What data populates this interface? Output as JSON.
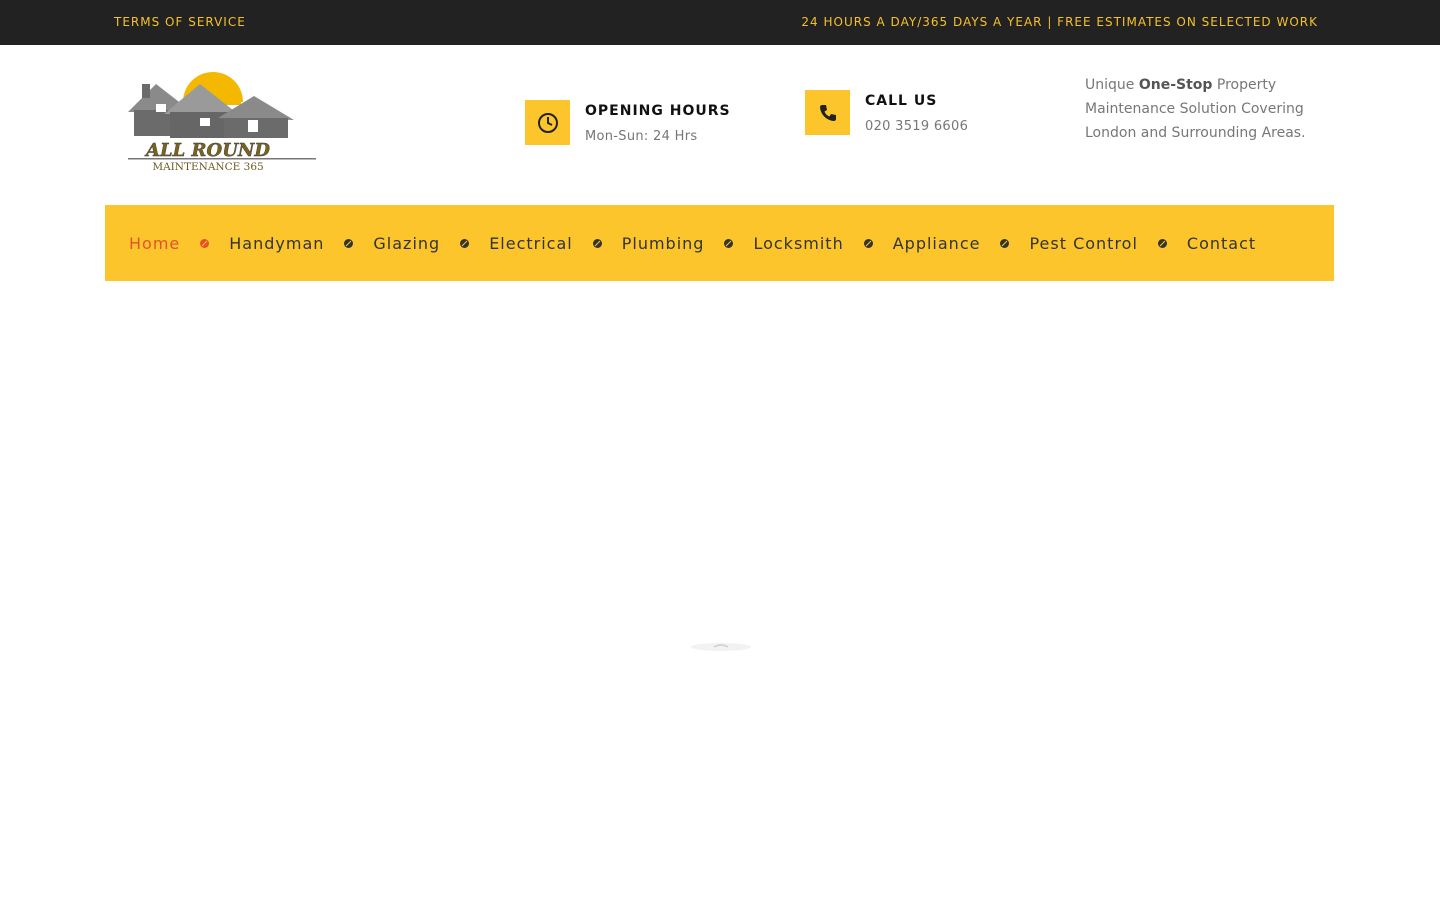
{
  "topbar": {
    "left_link": "TERMS OF SERVICE",
    "right_text": "24 HOURS A DAY/365 DAYS A YEAR | FREE ESTIMATES ON SELECTED WORK"
  },
  "logo": {
    "line1": "ALL ROUND",
    "line2": "MAINTENANCE 365"
  },
  "hours": {
    "icon": "clock-icon",
    "title": "OPENING HOURS",
    "text": "Mon-Sun: 24 Hrs"
  },
  "call": {
    "icon": "phone-icon",
    "title": "CALL US",
    "text": "020 3519 6606"
  },
  "intro": {
    "pre": "Unique ",
    "bold": "One-Stop",
    "post": " Property Maintenance Solution Covering London and Surrounding Areas."
  },
  "nav": {
    "items": [
      "Home",
      "Handyman",
      "Glazing",
      "Electrical",
      "Plumbing",
      "Locksmith",
      "Appliance",
      "Pest Control",
      "Contact"
    ],
    "active": "Home"
  },
  "colors": {
    "accent": "#fcc52c",
    "topbar_bg": "#222222",
    "active_link": "#e0542b"
  }
}
